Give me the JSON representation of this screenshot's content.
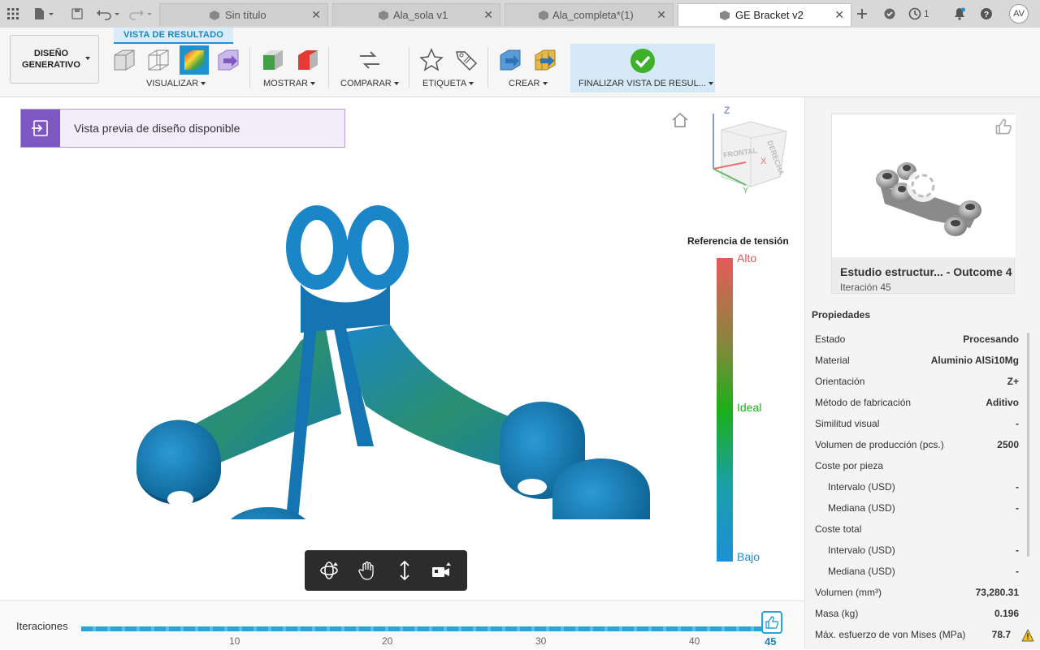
{
  "tabs": [
    {
      "label": "Sin título",
      "active": false
    },
    {
      "label": "Ala_sola v1",
      "active": false
    },
    {
      "label": "Ala_completa*(1)",
      "active": false
    },
    {
      "label": "GE Bracket v2",
      "active": true
    }
  ],
  "topbar": {
    "jobs_count": "1",
    "user_initials": "AV"
  },
  "toolbar": {
    "workspace_label": "DISEÑO GENERATIVO",
    "result_tab": "VISTA DE RESULTADO",
    "groups": {
      "visualize": "VISUALIZAR",
      "show": "MOSTRAR",
      "compare": "COMPARAR",
      "tag": "ETIQUETA",
      "create": "CREAR",
      "finish": "FINALIZAR VISTA DE RESUL..."
    }
  },
  "canvas": {
    "banner_text": "Vista previa de diseño disponible",
    "viewcube": {
      "front": "FRONTAL",
      "right": "DERECHA",
      "axis_z": "Z",
      "axis_y": "Y",
      "axis_x": "X"
    },
    "legend": {
      "title": "Referencia de tensión",
      "high": "Alto",
      "ideal": "Ideal",
      "low": "Bajo",
      "colors": {
        "high": "#e65a5a",
        "ideal": "#1ab01a",
        "low": "#1e90d8"
      }
    }
  },
  "iterations": {
    "label": "Iteraciones",
    "ticks": [
      "10",
      "20",
      "30",
      "40"
    ],
    "current": "45"
  },
  "panel": {
    "card_title": "Estudio estructur... - Outcome 4",
    "card_subtitle": "Iteración 45",
    "properties_title": "Propiedades",
    "properties": [
      {
        "key": "Estado",
        "value": "Procesando",
        "indent": false
      },
      {
        "key": "Material",
        "value": "Aluminio AlSi10Mg",
        "indent": false
      },
      {
        "key": "Orientación",
        "value": "Z+",
        "indent": false
      },
      {
        "key": "Método de fabricación",
        "value": "Aditivo",
        "indent": false
      },
      {
        "key": "Similitud visual",
        "value": "-",
        "indent": false
      },
      {
        "key": "Volumen de producción (pcs.)",
        "value": "2500",
        "indent": false
      },
      {
        "key": "Coste por pieza",
        "value": "",
        "indent": false
      },
      {
        "key": "Intervalo (USD)",
        "value": "-",
        "indent": true
      },
      {
        "key": "Mediana (USD)",
        "value": "-",
        "indent": true
      },
      {
        "key": "Coste total",
        "value": "",
        "indent": false
      },
      {
        "key": "Intervalo (USD)",
        "value": "-",
        "indent": true
      },
      {
        "key": "Mediana (USD)",
        "value": "-",
        "indent": true
      },
      {
        "key": "Volumen (mm³)",
        "value": "73,280.31",
        "indent": false
      },
      {
        "key": "Masa (kg)",
        "value": "0.196",
        "indent": false
      },
      {
        "key": "Máx. esfuerzo de von Mises (MPa)",
        "value": "78.7",
        "indent": false
      }
    ]
  }
}
